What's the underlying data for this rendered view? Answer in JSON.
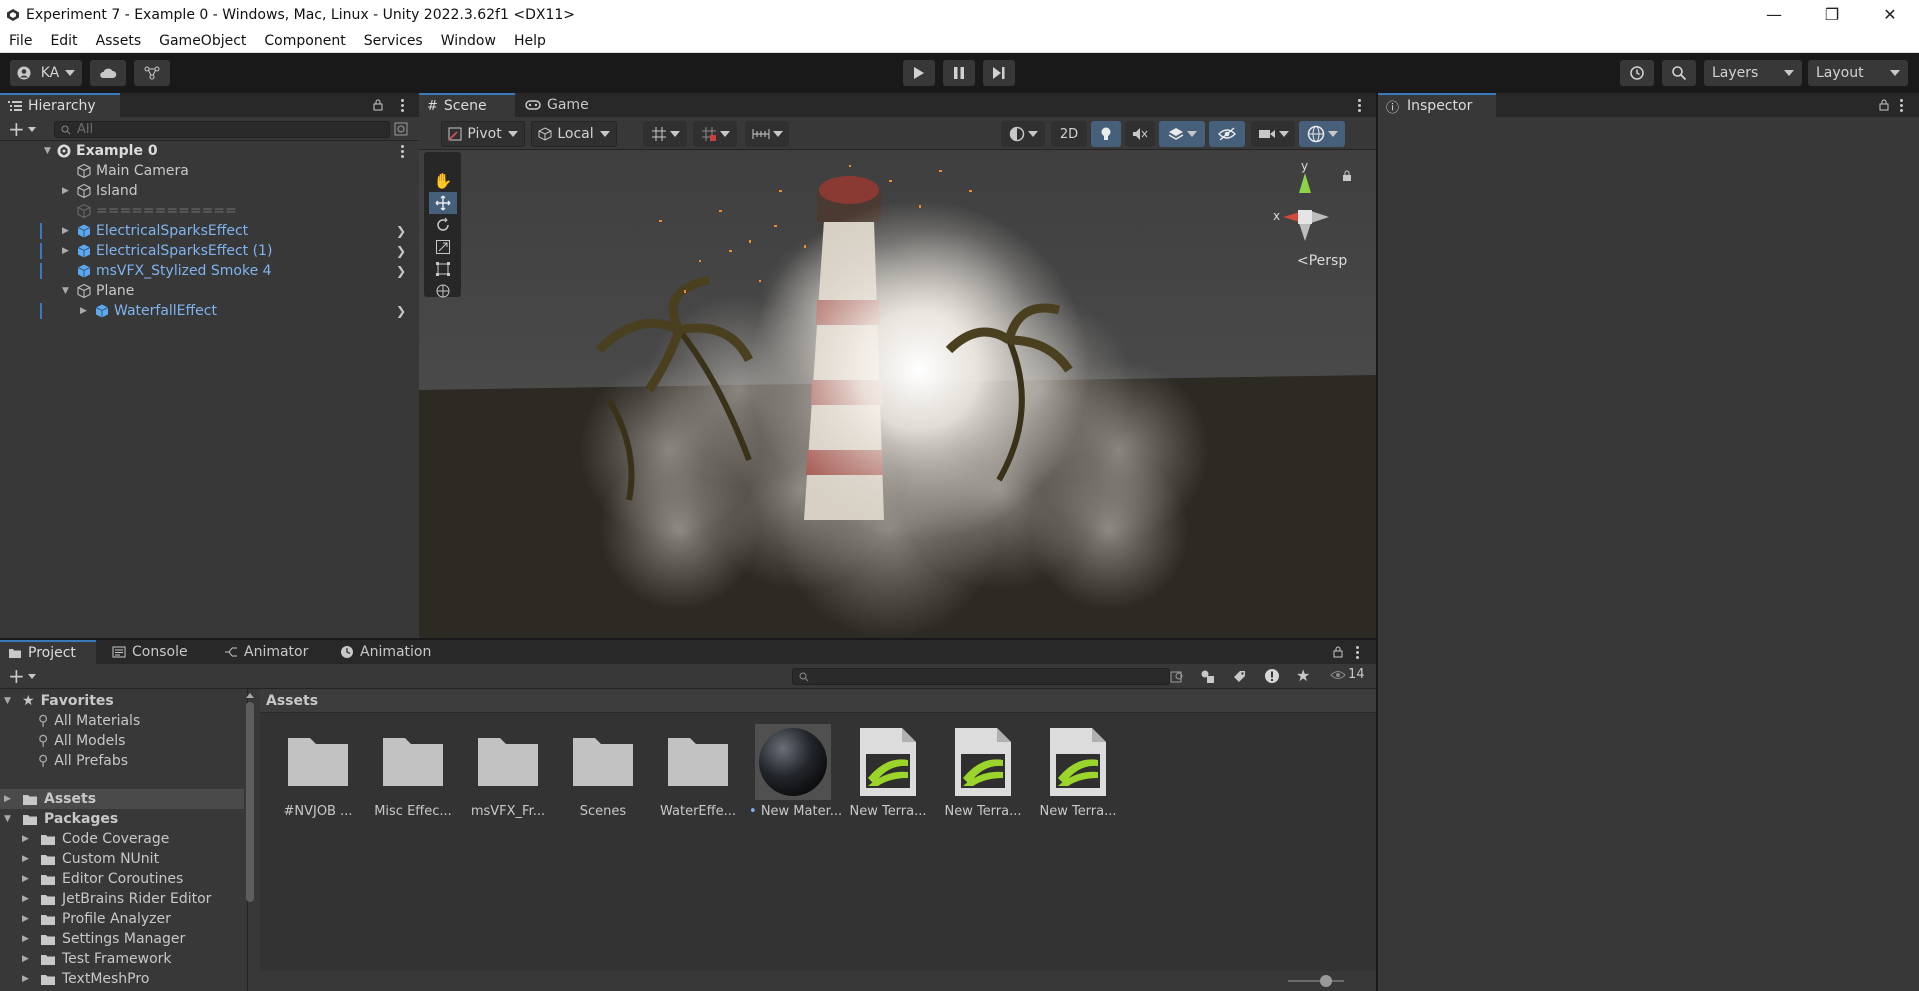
{
  "window": {
    "title": "Experiment 7 - Example 0 - Windows, Mac, Linux - Unity 2022.3.62f1 <DX11>",
    "controls": [
      "—",
      "❐",
      "✕"
    ]
  },
  "menu": [
    "File",
    "Edit",
    "Assets",
    "GameObject",
    "Component",
    "Services",
    "Window",
    "Help"
  ],
  "toolbar": {
    "account": "KA",
    "layers": "Layers",
    "layout": "Layout"
  },
  "hierarchy": {
    "tab": "Hierarchy",
    "search_placeholder": "All",
    "scene": "Example 0",
    "items": [
      {
        "label": "Main Camera",
        "style": "normal",
        "expand": false
      },
      {
        "label": "Island",
        "style": "normal",
        "expand": true
      },
      {
        "label": "============",
        "style": "disabled",
        "expand": false
      },
      {
        "label": "ElectricalSparksEffect",
        "style": "prefab",
        "expand": true
      },
      {
        "label": "ElectricalSparksEffect (1)",
        "style": "prefab",
        "expand": true
      },
      {
        "label": "msVFX_Stylized Smoke 4",
        "style": "prefab",
        "expand": false
      },
      {
        "label": "Plane",
        "style": "normal",
        "expand": true
      },
      {
        "label": "WaterfallEffect",
        "style": "prefab",
        "expand": true
      }
    ]
  },
  "scene": {
    "tabs": [
      "Scene",
      "Game"
    ],
    "pivot": "Pivot",
    "local": "Local",
    "mode_2d": "2D",
    "gizmo": {
      "x": "x",
      "y": "y",
      "persp": "Persp"
    }
  },
  "inspector": {
    "tab": "Inspector"
  },
  "bottom": {
    "tabs": [
      "Project",
      "Console",
      "Animator",
      "Animation"
    ],
    "hidden_count": "14",
    "favorites": {
      "title": "Favorites",
      "items": [
        "All Materials",
        "All Models",
        "All Prefabs"
      ]
    },
    "assets_root": "Assets",
    "packages_root": "Packages",
    "packages": [
      "Code Coverage",
      "Custom NUnit",
      "Editor Coroutines",
      "JetBrains Rider Editor",
      "Profile Analyzer",
      "Settings Manager",
      "Test Framework",
      "TextMeshPro"
    ],
    "breadcrumb": "Assets",
    "assets": [
      {
        "label": "#NVJOB ...",
        "kind": "folder"
      },
      {
        "label": "Misc Effec...",
        "kind": "folder"
      },
      {
        "label": "msVFX_Fr...",
        "kind": "folder"
      },
      {
        "label": "Scenes",
        "kind": "folder"
      },
      {
        "label": "WaterEffe...",
        "kind": "folder"
      },
      {
        "label": "New Mater...",
        "kind": "material"
      },
      {
        "label": "New Terra...",
        "kind": "terrain"
      },
      {
        "label": "New Terra...",
        "kind": "terrain"
      },
      {
        "label": "New Terra...",
        "kind": "terrain"
      }
    ]
  },
  "colors": {
    "accent": "#3a79bb",
    "prefab_text": "#7fb4ee",
    "panel": "#383838",
    "dark": "#282828"
  }
}
